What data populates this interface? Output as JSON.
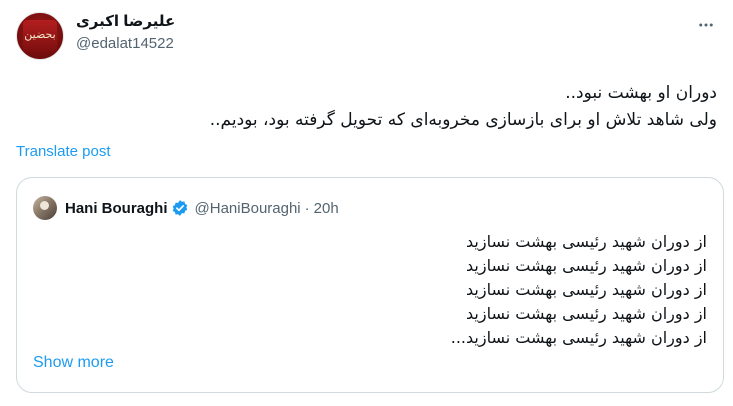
{
  "post": {
    "author": {
      "display_name": "علیرضا اکبری",
      "handle": "@edalat14522",
      "avatar_icon": "red-emblem-avatar",
      "avatar_text": "بحضین"
    },
    "more_icon": "more-horizontal-icon",
    "text_lines": [
      "دوران او بهشت نبود..",
      "ولی شاهد تلاش او برای بازسازی مخروبه‌ای که تحویل گرفته بود، بودیم.."
    ],
    "translate_label": "Translate post"
  },
  "quoted": {
    "display_name": "Hani Bouraghi",
    "verified_icon": "verified-badge-icon",
    "handle": "@HaniBouraghi",
    "separator": "·",
    "time": "20h",
    "lines": [
      "از دوران شهید رئیسی بهشت نسازید",
      "از دوران شهید رئیسی بهشت نسازید",
      "از دوران شهید رئیسی بهشت نسازید",
      "از دوران شهید رئیسی بهشت نسازید",
      "از دوران شهید رئیسی بهشت نسازید..."
    ],
    "show_more_label": "Show more"
  },
  "colors": {
    "link": "#1d9bf0",
    "secondary_text": "#536471",
    "border": "#cfd9de"
  }
}
